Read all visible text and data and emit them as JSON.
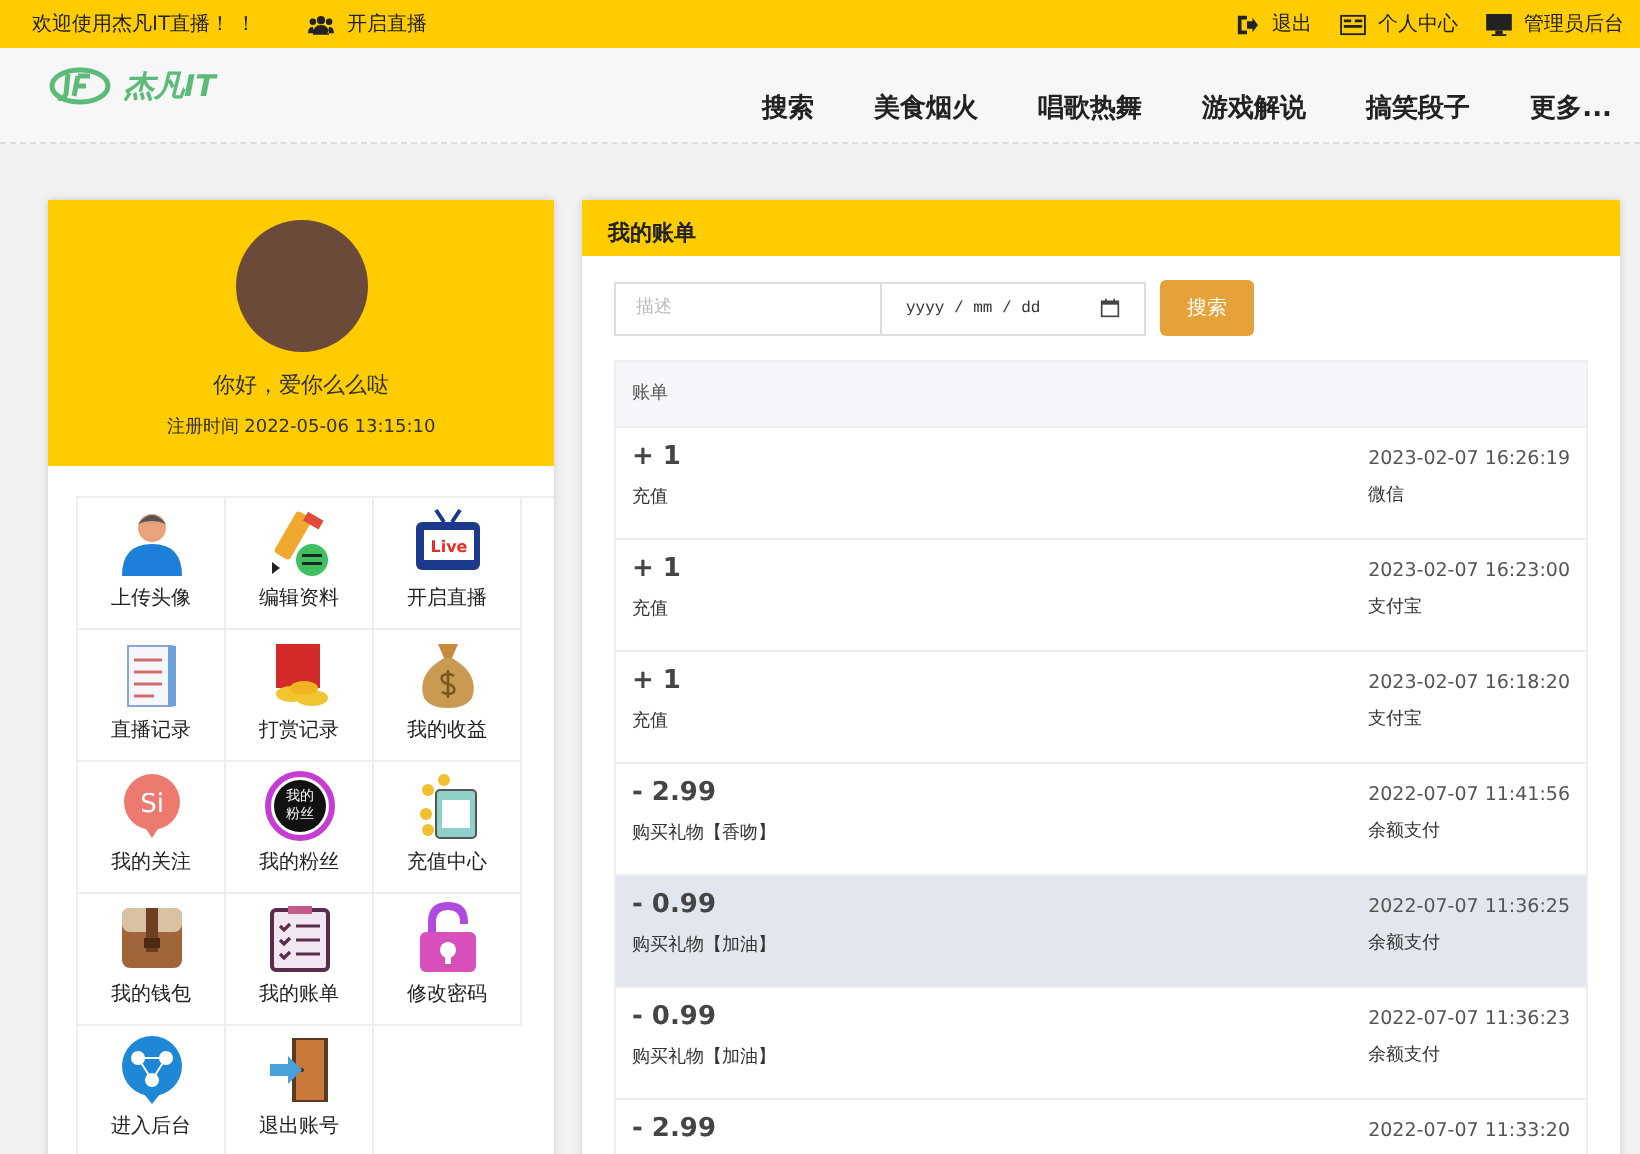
{
  "topbar": {
    "welcome": "欢迎使用杰凡IT直播！ ！",
    "live_link": "开启直播",
    "links": [
      {
        "kind": "logout",
        "label": "退出"
      },
      {
        "kind": "profile",
        "label": "个人中心"
      },
      {
        "kind": "admin",
        "label": "管理员后台"
      }
    ]
  },
  "header": {
    "logo_text": "杰凡IT",
    "nav": [
      "搜索",
      "美食烟火",
      "唱歌热舞",
      "游戏解说",
      "搞笑段子",
      "更多..."
    ]
  },
  "profile": {
    "greeting": "你好，爱你么么哒",
    "registered": "注册时间 2022-05-06 13:15:10"
  },
  "menu": [
    {
      "kind": "user",
      "label": "上传头像"
    },
    {
      "kind": "edit",
      "label": "编辑资料"
    },
    {
      "kind": "live",
      "label": "开启直播",
      "badge": "Live"
    },
    {
      "kind": "record",
      "label": "直播记录"
    },
    {
      "kind": "reward",
      "label": "打赏记录"
    },
    {
      "kind": "income",
      "label": "我的收益"
    },
    {
      "kind": "follow",
      "label": "我的关注",
      "badge": "Si"
    },
    {
      "kind": "fans",
      "label": "我的粉丝",
      "badge": "我的粉丝"
    },
    {
      "kind": "recharge",
      "label": "充值中心"
    },
    {
      "kind": "wallet",
      "label": "我的钱包"
    },
    {
      "kind": "bill",
      "label": "我的账单"
    },
    {
      "kind": "password",
      "label": "修改密码"
    },
    {
      "kind": "admin",
      "label": "进入后台"
    },
    {
      "kind": "logout",
      "label": "退出账号"
    }
  ],
  "bills": {
    "title": "我的账单",
    "search": {
      "placeholder": "描述",
      "date_placeholder": "yyyy / mm / dd",
      "button": "搜索"
    },
    "column": "账单",
    "rows": [
      {
        "amount": "+ 1",
        "desc": "充值",
        "time": "2023-02-07 16:26:19",
        "method": "微信",
        "highlighted": false
      },
      {
        "amount": "+ 1",
        "desc": "充值",
        "time": "2023-02-07 16:23:00",
        "method": "支付宝",
        "highlighted": false
      },
      {
        "amount": "+ 1",
        "desc": "充值",
        "time": "2023-02-07 16:18:20",
        "method": "支付宝",
        "highlighted": false
      },
      {
        "amount": "- 2.99",
        "desc": "购买礼物【香吻】",
        "time": "2022-07-07 11:41:56",
        "method": "余额支付",
        "highlighted": false
      },
      {
        "amount": "- 0.99",
        "desc": "购买礼物【加油】",
        "time": "2022-07-07 11:36:25",
        "method": "余额支付",
        "highlighted": true
      },
      {
        "amount": "- 0.99",
        "desc": "购买礼物【加油】",
        "time": "2022-07-07 11:36:23",
        "method": "余额支付",
        "highlighted": false
      },
      {
        "amount": "- 2.99",
        "time": "2022-07-07 11:33:20",
        "highlighted": false
      }
    ]
  }
}
